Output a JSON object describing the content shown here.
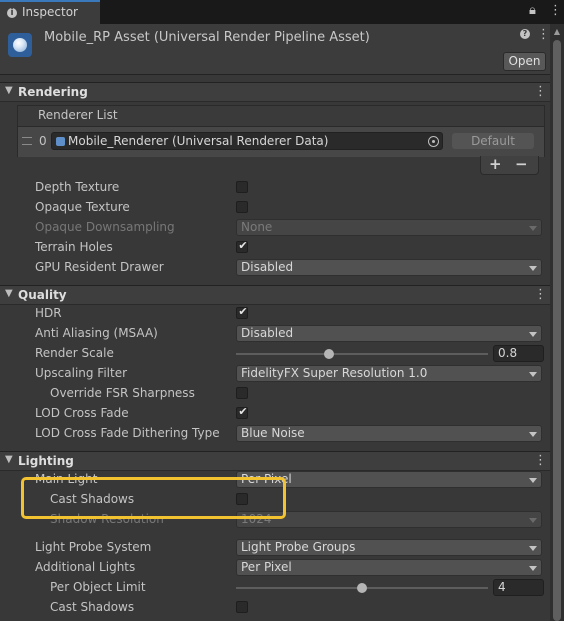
{
  "tab": {
    "label": "Inspector"
  },
  "header": {
    "title": "Mobile_RP Asset (Universal Render Pipeline Asset)",
    "open_label": "Open"
  },
  "sections": {
    "rendering": "Rendering",
    "quality": "Quality",
    "lighting": "Lighting"
  },
  "renderer_list": {
    "title": "Renderer List",
    "index": "0",
    "renderer": "Mobile_Renderer (Universal Renderer Data)",
    "default_label": "Default",
    "add": "+",
    "remove": "−"
  },
  "rendering": {
    "depth_texture": {
      "label": "Depth Texture",
      "checked": false
    },
    "opaque_texture": {
      "label": "Opaque Texture",
      "checked": false
    },
    "opaque_downsampling": {
      "label": "Opaque Downsampling",
      "value": "None",
      "disabled": true
    },
    "terrain_holes": {
      "label": "Terrain Holes",
      "checked": true
    },
    "gpu_resident_drawer": {
      "label": "GPU Resident Drawer",
      "value": "Disabled"
    }
  },
  "quality": {
    "hdr": {
      "label": "HDR",
      "checked": true
    },
    "anti_aliasing": {
      "label": "Anti Aliasing (MSAA)",
      "value": "Disabled"
    },
    "render_scale": {
      "label": "Render Scale",
      "value": "0.8",
      "min": 0.1,
      "max": 2.0
    },
    "upscaling_filter": {
      "label": "Upscaling Filter",
      "value": "FidelityFX Super Resolution 1.0"
    },
    "override_fsr": {
      "label": "Override FSR Sharpness",
      "checked": false
    },
    "lod_cross_fade": {
      "label": "LOD Cross Fade",
      "checked": true
    },
    "lod_dithering": {
      "label": "LOD Cross Fade Dithering Type",
      "value": "Blue Noise"
    }
  },
  "lighting": {
    "main_light": {
      "label": "Main Light",
      "value": "Per Pixel"
    },
    "main_cast_shadows": {
      "label": "Cast Shadows",
      "checked": false
    },
    "shadow_resolution": {
      "label": "Shadow Resolution",
      "value": "1024",
      "disabled": true
    },
    "light_probe_system": {
      "label": "Light Probe System",
      "value": "Light Probe Groups"
    },
    "additional_lights": {
      "label": "Additional Lights",
      "value": "Per Pixel"
    },
    "per_object_limit": {
      "label": "Per Object Limit",
      "value": "4",
      "min": 0,
      "max": 8
    },
    "additional_cast_shadows": {
      "label": "Cast Shadows",
      "checked": false
    }
  },
  "colors": {
    "highlight": "#f2c230",
    "accent": "#3a79bb"
  }
}
